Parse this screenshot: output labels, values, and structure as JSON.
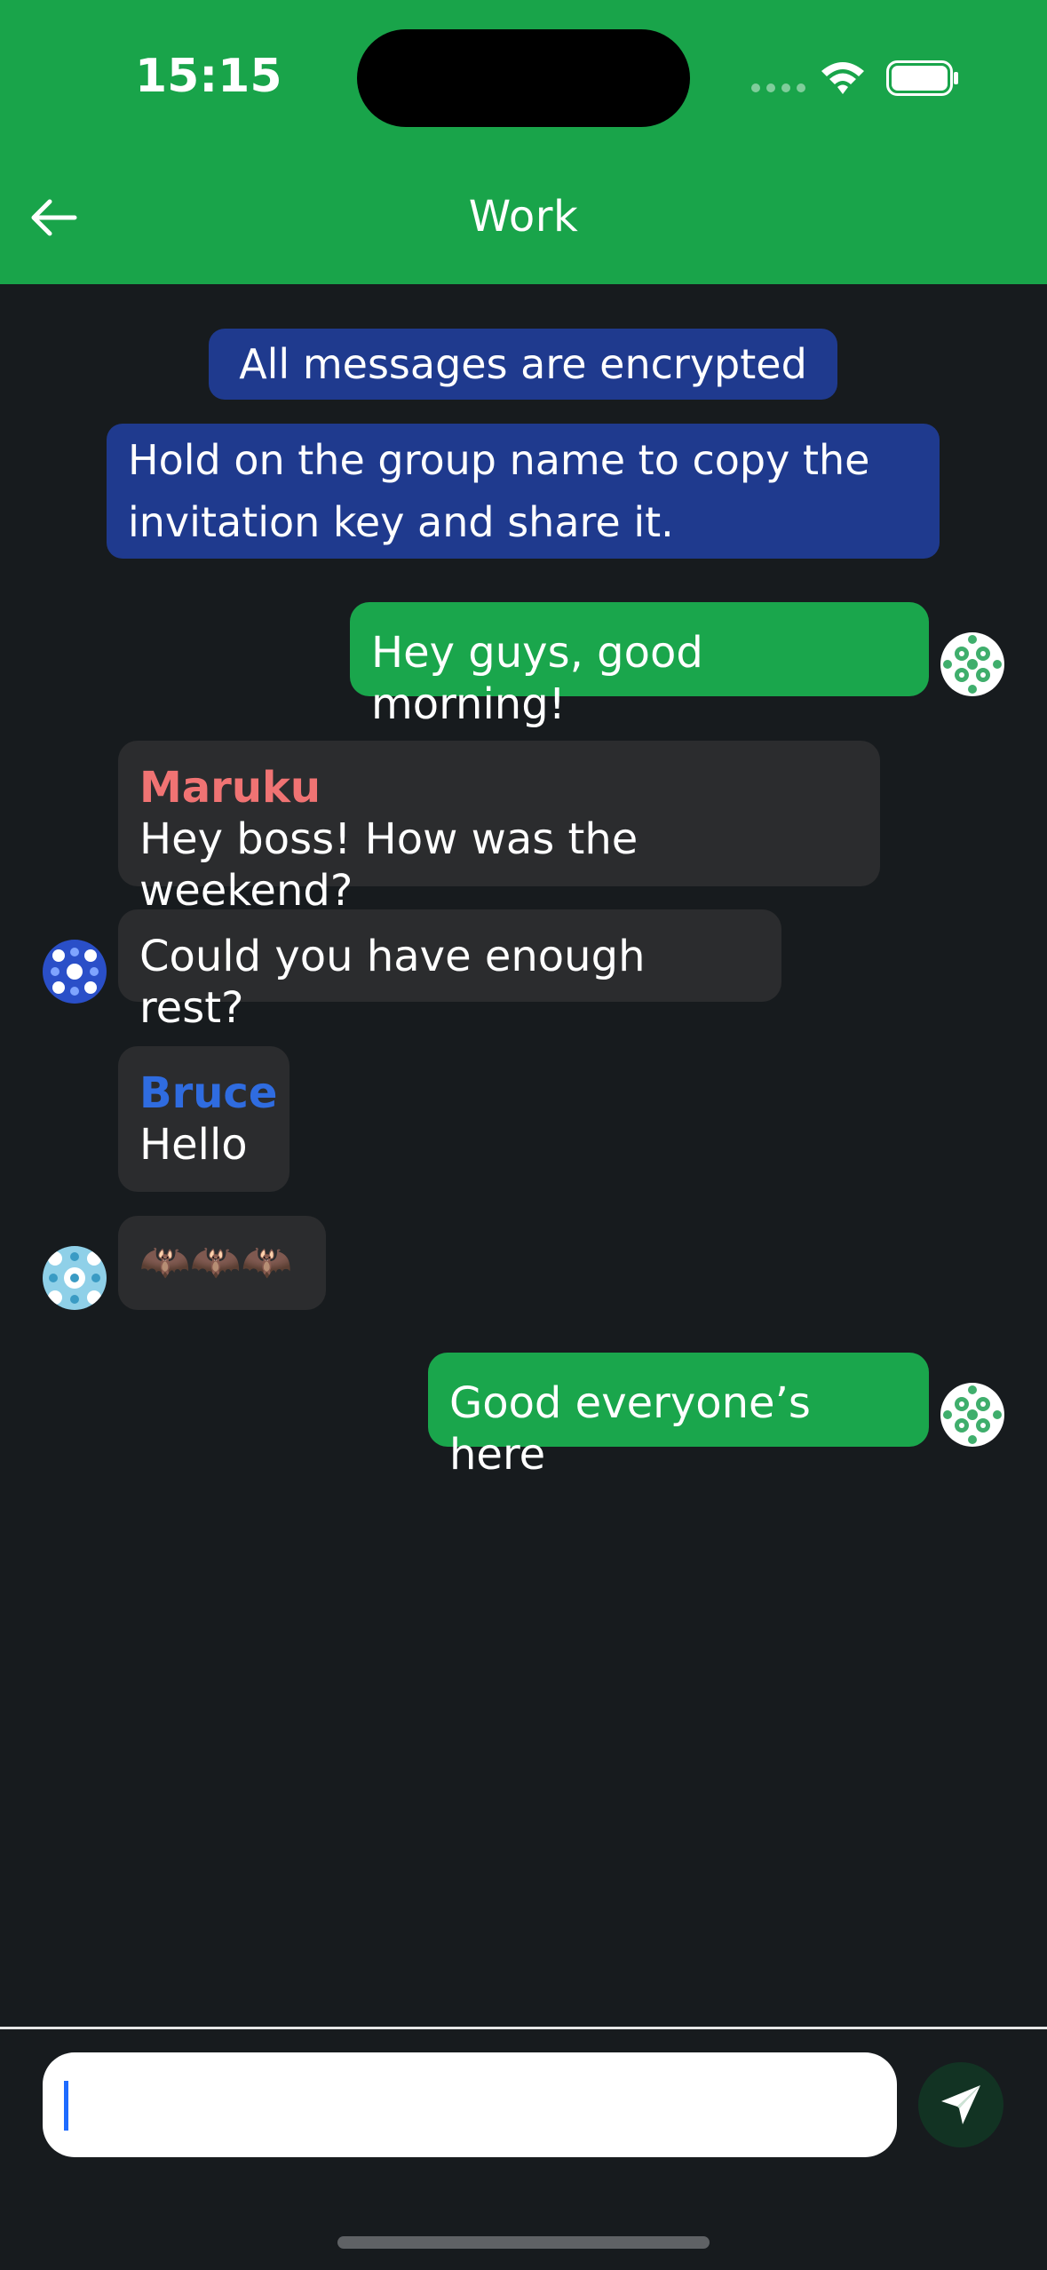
{
  "status_bar": {
    "time": "15:15"
  },
  "header": {
    "title": "Work",
    "back_icon": "arrow-left-icon"
  },
  "system_messages": [
    {
      "text": "All messages are encrypted"
    },
    {
      "lines": [
        "Hold on the group name to copy the",
        "invitation key and share it."
      ]
    }
  ],
  "messages": [
    {
      "direction": "outgoing",
      "text": "Hey guys, good morning!"
    },
    {
      "direction": "incoming",
      "sender": "Maruku",
      "sender_color": "#f07373",
      "text": "Hey boss! How was the weekend?"
    },
    {
      "direction": "incoming",
      "text": "Could you have enough rest?"
    },
    {
      "direction": "incoming",
      "sender": "Bruce",
      "sender_color": "#2f6ce0",
      "text": "Hello"
    },
    {
      "direction": "incoming",
      "text": "🦇🦇🦇"
    },
    {
      "direction": "outgoing",
      "text": "Good everyone’s here"
    }
  ],
  "composer": {
    "input_value": "",
    "placeholder": "",
    "send_icon": "paper-plane-icon"
  },
  "colors": {
    "header_bg": "#19a44a",
    "chat_bg": "#171b1e",
    "outgoing_bubble": "#1aa64c",
    "incoming_bubble": "#2b2c2e",
    "system_bubble": "#1f3a8e",
    "send_button_bg": "#123323"
  }
}
